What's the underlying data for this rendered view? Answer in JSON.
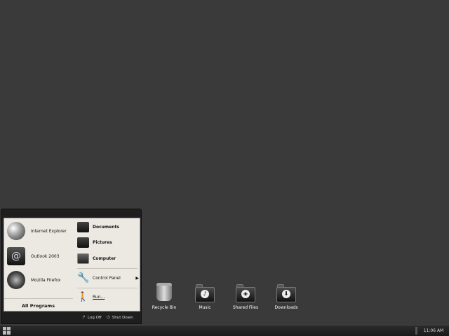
{
  "desktop": {
    "icons": [
      {
        "label": "Recycle Bin",
        "icon": "recycle-bin-icon"
      },
      {
        "label": "Music",
        "icon": "music-folder-icon",
        "emblem": "♪"
      },
      {
        "label": "Shared Files",
        "icon": "shared-folder-icon",
        "emblem": "◈"
      },
      {
        "label": "Downloads",
        "icon": "downloads-folder-icon",
        "emblem": "⬇"
      }
    ]
  },
  "start_menu": {
    "programs": [
      {
        "label": "Internet Explorer",
        "icon": "internet-explorer-icon"
      },
      {
        "label": "Outlook 2003",
        "icon": "outlook-icon",
        "glyph": "@"
      },
      {
        "label": "Mozilla Firefox",
        "icon": "firefox-icon"
      }
    ],
    "all_programs": "All Programs",
    "places": [
      {
        "label": "Documents",
        "icon": "documents-folder-icon"
      },
      {
        "label": "Pictures",
        "icon": "pictures-folder-icon"
      },
      {
        "label": "Computer",
        "icon": "computer-monitor-icon"
      },
      {
        "label": "Control Panel",
        "icon": "wrench-icon"
      },
      {
        "label": "Run...",
        "icon": "run-person-icon"
      }
    ],
    "footer": {
      "log_off": "Log Off",
      "shut_down": "Shut Down"
    }
  },
  "taskbar": {
    "clock": "11:06 AM"
  },
  "colors": {
    "desktop_background": "#3a3a3a",
    "menu_panel": "#ece9e3",
    "taskbar": "#1a1a1a"
  }
}
